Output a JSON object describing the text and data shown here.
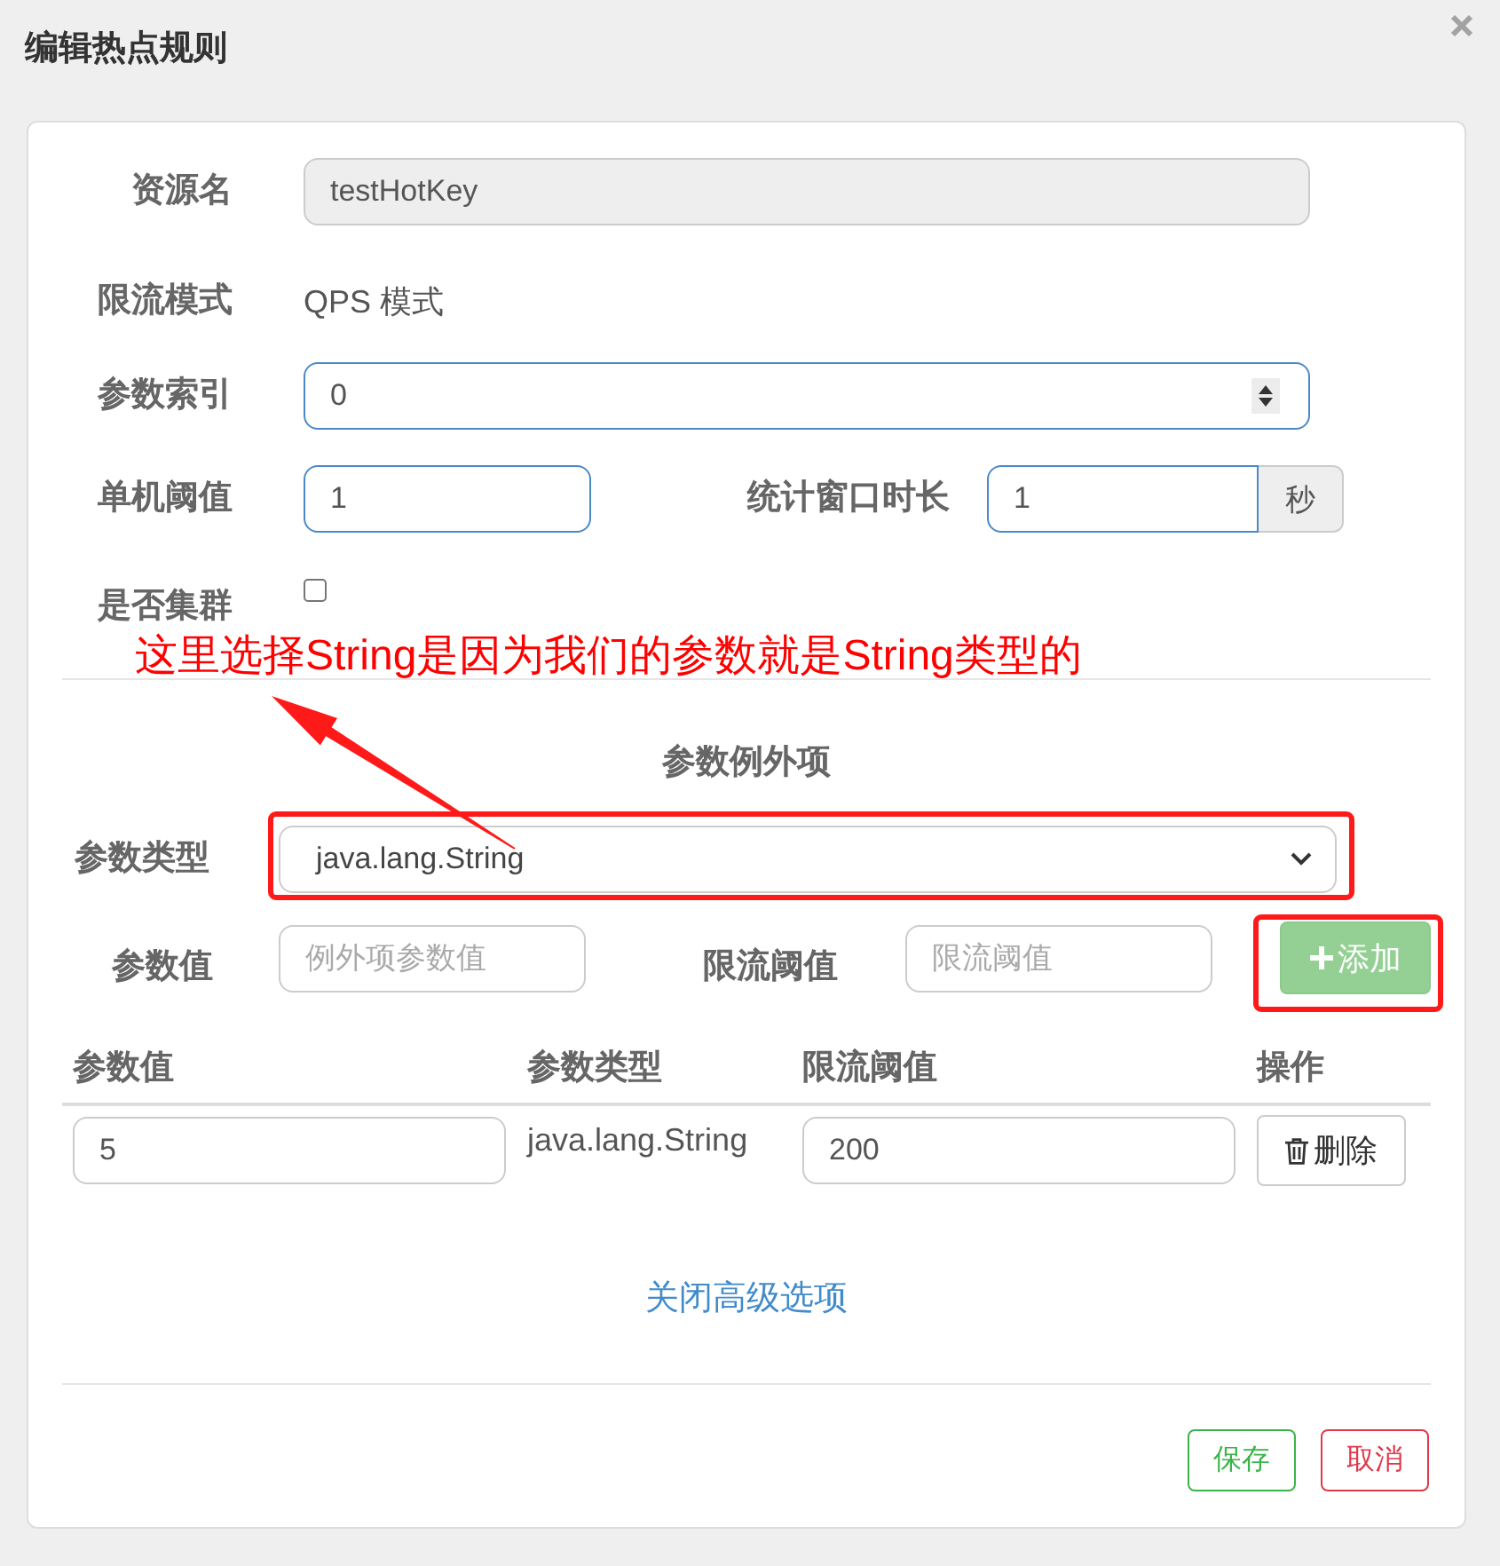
{
  "dialog": {
    "title": "编辑热点规则"
  },
  "form": {
    "resource": {
      "label": "资源名",
      "value": "testHotKey",
      "disabled": true
    },
    "mode": {
      "label": "限流模式",
      "value": "QPS 模式"
    },
    "param_index": {
      "label": "参数索引",
      "value": "0"
    },
    "threshold": {
      "label": "单机阈值",
      "value": "1"
    },
    "window": {
      "label": "统计窗口时长",
      "value": "1",
      "unit": "秒"
    },
    "cluster": {
      "label": "是否集群",
      "checked": false
    }
  },
  "annotation": {
    "text": "这里选择String是因为我们的参数就是String类型的"
  },
  "exceptions": {
    "title": "参数例外项",
    "type": {
      "label": "参数类型",
      "value": "java.lang.String"
    },
    "value": {
      "label": "参数值",
      "placeholder": "例外项参数值"
    },
    "limit": {
      "label": "限流阈值",
      "placeholder": "限流阈值"
    },
    "add_button": {
      "label": "添加",
      "disabled": true
    }
  },
  "table": {
    "columns": [
      "参数值",
      "参数类型",
      "限流阈值",
      "操作"
    ],
    "rows": [
      {
        "value": "5",
        "type": "java.lang.String",
        "limit": "200",
        "action": "删除"
      }
    ]
  },
  "advanced_link": "关闭高级选项",
  "buttons": [
    {
      "label": "保存",
      "kind": "save"
    },
    {
      "label": "取消",
      "kind": "cancel"
    }
  ]
}
